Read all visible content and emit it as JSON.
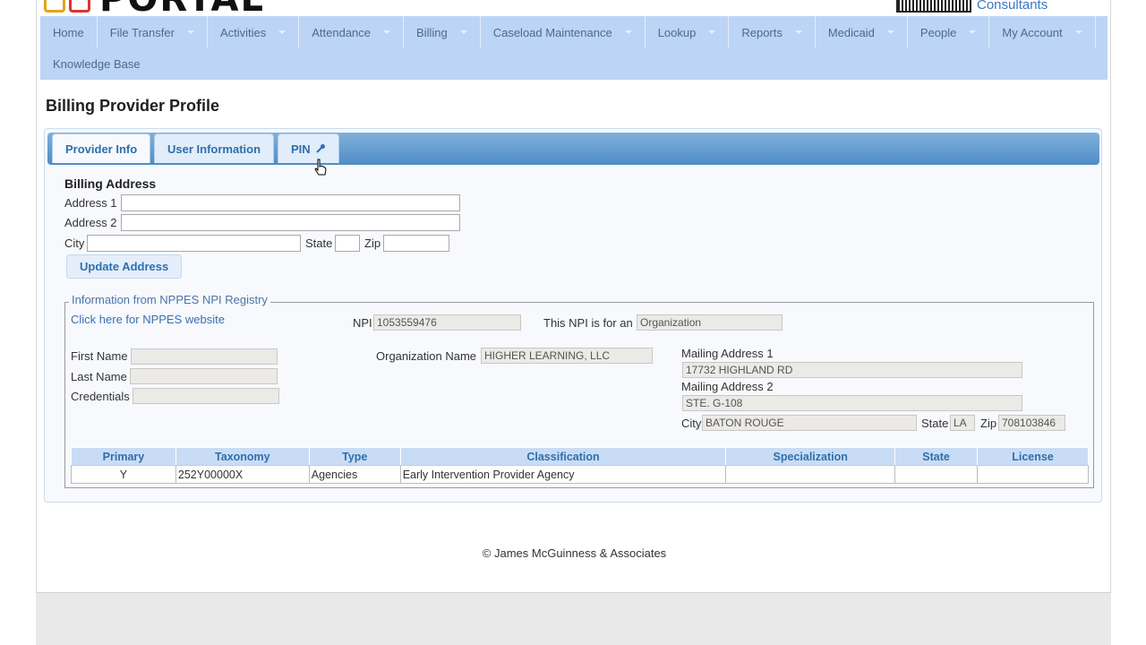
{
  "header": {
    "logo_text": "PORTAL",
    "consultants_text": "Consultants"
  },
  "nav": {
    "items": [
      {
        "label": "Home",
        "caret": false
      },
      {
        "label": "File Transfer",
        "caret": true
      },
      {
        "label": "Activities",
        "caret": true
      },
      {
        "label": "Attendance",
        "caret": true
      },
      {
        "label": "Billing",
        "caret": true
      },
      {
        "label": "Caseload Maintenance",
        "caret": true
      },
      {
        "label": "Lookup",
        "caret": true
      },
      {
        "label": "Reports",
        "caret": true
      },
      {
        "label": "Medicaid",
        "caret": true
      },
      {
        "label": "People",
        "caret": true
      },
      {
        "label": "My Account",
        "caret": true
      }
    ],
    "row2": "Knowledge Base"
  },
  "page": {
    "title": "Billing Provider Profile"
  },
  "tabs": [
    {
      "label": "Provider Info",
      "active": true
    },
    {
      "label": "User Information",
      "active": false
    },
    {
      "label": "PIN",
      "active": false
    }
  ],
  "billing": {
    "heading": "Billing Address",
    "address1_label": "Address 1",
    "address1_value": "",
    "address2_label": "Address 2",
    "address2_value": "",
    "city_label": "City",
    "city_value": "",
    "state_label": "State",
    "state_value": "",
    "zip_label": "Zip",
    "zip_value": "",
    "update_button": "Update Address"
  },
  "nppes": {
    "legend": "Information from NPPES NPI Registry",
    "link": "Click here for NPPES website",
    "npi_label": "NPI",
    "npi_value": "1053559476",
    "npi_type_label": "This NPI is for an",
    "npi_type_value": "Organization",
    "first_name_label": "First Name",
    "first_name_value": "",
    "last_name_label": "Last Name",
    "last_name_value": "",
    "credentials_label": "Credentials",
    "credentials_value": "",
    "org_name_label": "Organization Name",
    "org_name_value": "HIGHER LEARNING, LLC",
    "mailing1_label": "Mailing Address 1",
    "mailing1_value": "17732 HIGHLAND RD",
    "mailing2_label": "Mailing Address 2",
    "mailing2_value": "STE. G-108",
    "city_label": "City",
    "city_value": "BATON ROUGE",
    "state_label": "State",
    "state_value": "LA",
    "zip_label": "Zip",
    "zip_value": "708103846"
  },
  "taxonomy_table": {
    "headers": [
      "Primary",
      "Taxonomy",
      "Type",
      "Classification",
      "Specialization",
      "State",
      "License"
    ],
    "rows": [
      [
        "Y",
        "252Y00000X",
        "Agencies",
        "Early Intervention Provider Agency",
        "",
        "",
        ""
      ]
    ]
  },
  "footer": {
    "text": "© James McGuinness & Associates"
  }
}
